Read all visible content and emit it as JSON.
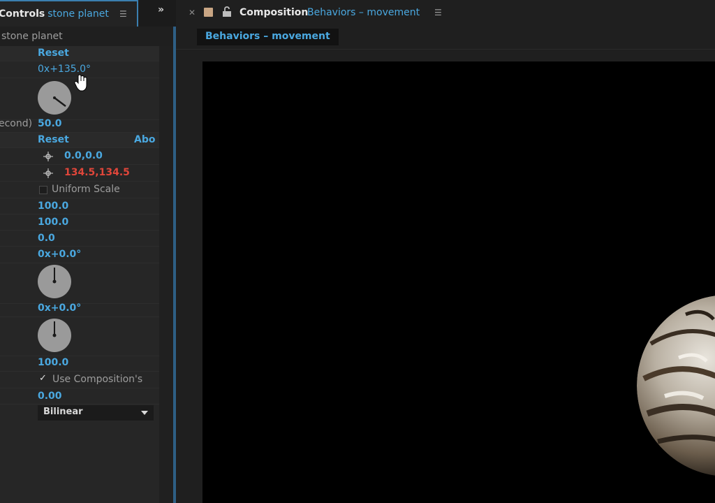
{
  "effect_controls": {
    "tab_title": "Controls",
    "layer_name": "stone planet",
    "overflow_icon": "double-chevron-right-icon",
    "panel_menu_icon": "hamburger-icon",
    "subheader": "stone planet",
    "reset_label_1": "Reset",
    "rotation_value": "0x+135.0°",
    "speed_label": "econd)",
    "speed_value": "50.0",
    "reset_label_2": "Reset",
    "about_label": "Abo",
    "point_a_value": "0.0,0.0",
    "point_b_value": "134.5,134.5",
    "uniform_scale_label": "Uniform Scale",
    "scale_value_1": "100.0",
    "scale_value_2": "100.0",
    "skew_value": "0.0",
    "angle_value_1": "0x+0.0°",
    "angle_value_2": "0x+0.0°",
    "opacity_value": "100.0",
    "use_composition_label": "Use Composition's",
    "shutter_value": "0.00",
    "sampling_selected": "Bilinear"
  },
  "composition": {
    "close_icon": "close-icon",
    "lock_icon": "lock-icon",
    "title": "Composition",
    "comp_name": "Behaviors – movement",
    "panel_menu_icon": "hamburger-icon",
    "active_tab": "Behaviors – movement"
  },
  "colors": {
    "accent_blue": "#4aa8e0",
    "keyframe_red": "#e0463a",
    "panel_bg": "#232323",
    "viewer_bg": "#000000",
    "comp_swatch": "#c9a684"
  }
}
